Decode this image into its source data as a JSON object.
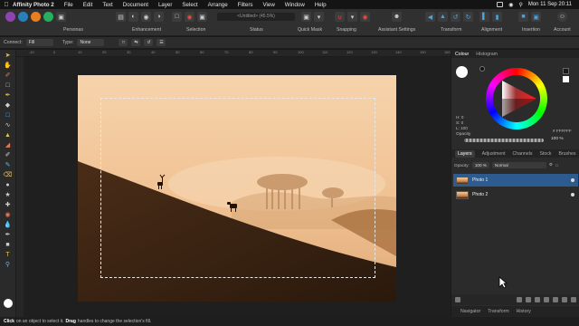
{
  "menubar": {
    "app_name": "Affinity Photo 2",
    "items": [
      "File",
      "Edit",
      "Text",
      "Document",
      "Layer",
      "Select",
      "Arrange",
      "Filters",
      "View",
      "Window",
      "Help"
    ],
    "clock": "Mon 11 Sep  20:11"
  },
  "toolbar": {
    "personas_label": "Personas",
    "enhancement_label": "Enhancement",
    "selection_label": "Selection",
    "status_label": "Status",
    "status_text": "<Untitled> (45.5%)",
    "quickmask_label": "Quick Mask",
    "snapping_label": "Snapping",
    "assistant_label": "Assistant Settings",
    "transform_label": "Transform",
    "alignment_label": "Alignment",
    "insertion_label": "Insertion",
    "account_label": "Account"
  },
  "context": {
    "connect_label": "Connect:",
    "connect_value": "Fill",
    "type_label": "Type:",
    "type_value": "None"
  },
  "ruler": {
    "ticks": [
      "-10",
      "0",
      "10",
      "20",
      "30",
      "40",
      "50",
      "60",
      "70",
      "80",
      "90",
      "100",
      "110",
      "120",
      "130",
      "140",
      "150",
      "160"
    ]
  },
  "colour_panel": {
    "tab_colour": "Colour",
    "tab_histogram": "Histogram",
    "h": "H: 0",
    "s": "S: 0",
    "l": "L: 100",
    "hex": "# FFFFFF",
    "opacity_label": "Opacity",
    "opacity_value": "100 %"
  },
  "layers_panel": {
    "tabs": [
      "Layers",
      "Adjustment",
      "Channels",
      "Stock",
      "Brushes"
    ],
    "opacity_label": "Opacity:",
    "opacity_value": "100 %",
    "blend_mode": "Normal",
    "layers": [
      {
        "name": "Photo 1",
        "selected": true
      },
      {
        "name": "Photo 2",
        "selected": false
      }
    ]
  },
  "bottom_tabs": [
    "Navigator",
    "Transform",
    "History"
  ],
  "statusbar": {
    "click": "Click",
    "t1": "on an object to select it.",
    "drag": "Drag",
    "t2": "handles to change the selection's fill."
  },
  "colors": {
    "accent": "#2e5b8f",
    "photo_sky": "#f1c89b",
    "photo_hill": "#3a2516"
  }
}
